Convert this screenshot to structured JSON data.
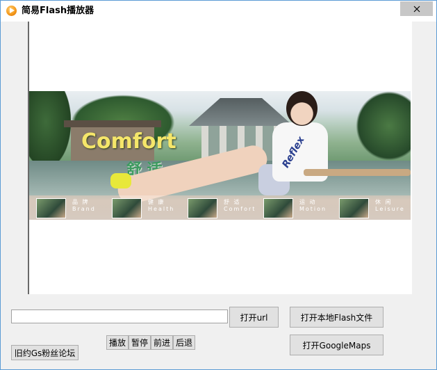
{
  "window": {
    "title": "简易Flash播放器",
    "close_glyph": "✕"
  },
  "banner": {
    "heading": "Comfort",
    "subheading": "舒 适",
    "shirt_text": "Reflex",
    "nav": [
      {
        "title": "品 牌",
        "sub": "Brand"
      },
      {
        "title": "健 康",
        "sub": "Health"
      },
      {
        "title": "舒 适",
        "sub": "Comfort"
      },
      {
        "title": "运 动",
        "sub": "Motion"
      },
      {
        "title": "休 闲",
        "sub": "Leisure"
      }
    ]
  },
  "controls": {
    "url_value": "",
    "open_url": "打开url",
    "open_local": "打开本地Flash文件",
    "open_maps": "打开GoogleMaps",
    "play": "播放",
    "pause": "暂停",
    "forward": "前进",
    "back": "后退",
    "forum": "旧约Gs粉丝论坛"
  },
  "colors": {
    "window_border": "#5b9bd5",
    "close_bg": "#c7c7c7",
    "heading_yellow": "#f5e66a",
    "subheading_green": "#3c9a5f"
  }
}
